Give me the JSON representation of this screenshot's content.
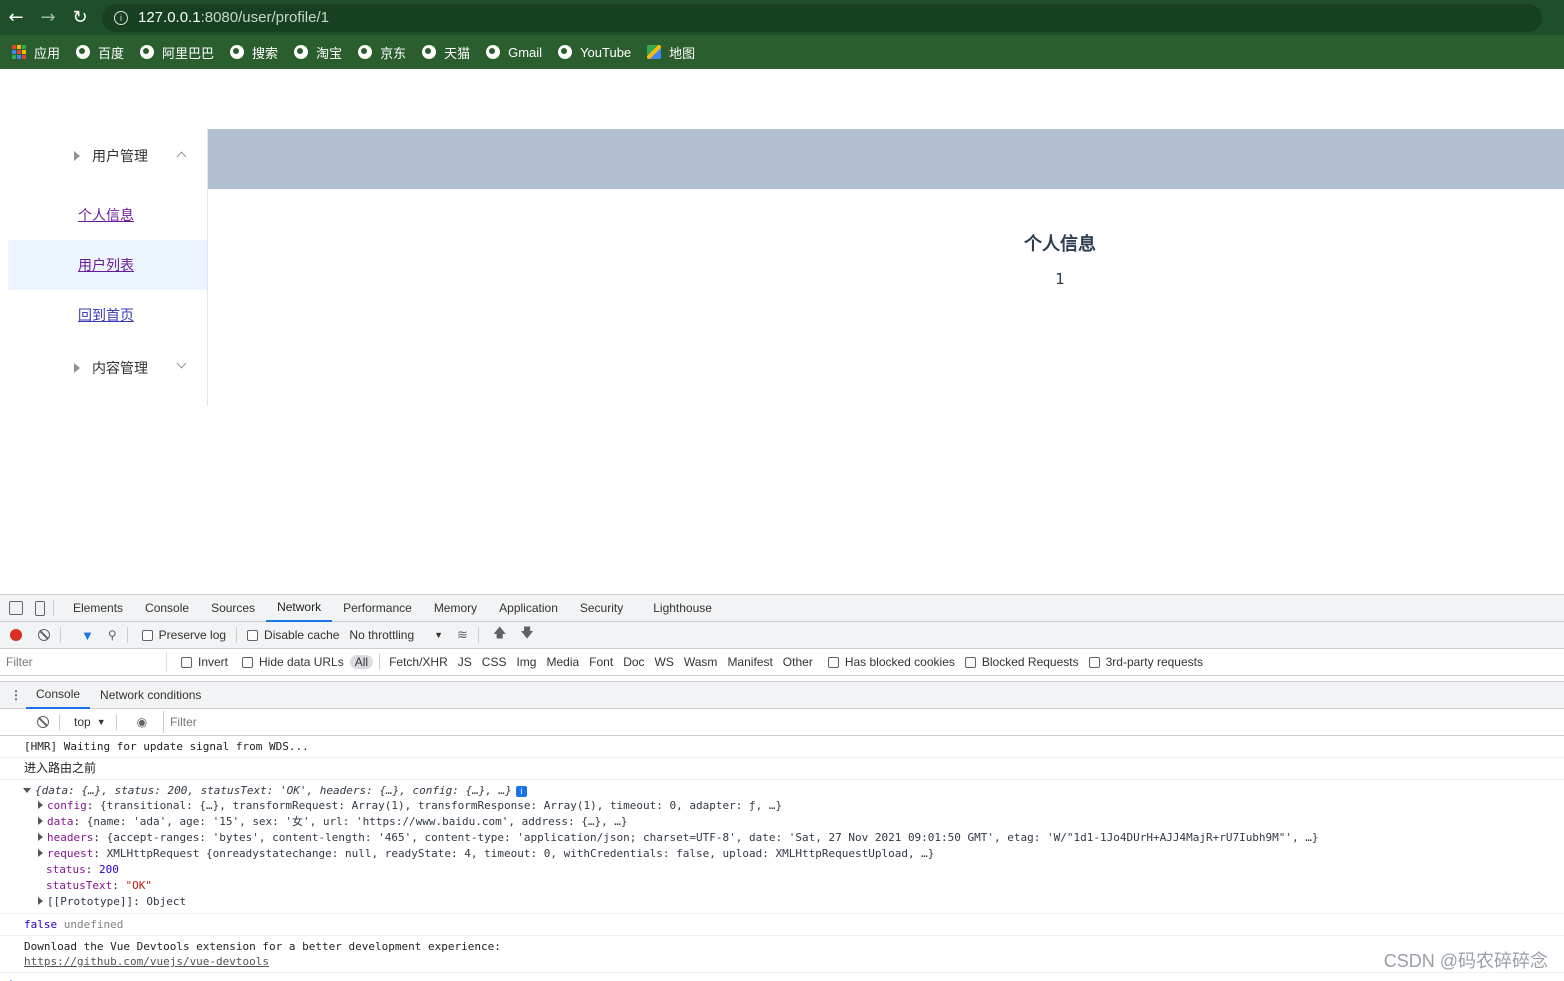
{
  "browser": {
    "url_host": "127.0.0.1",
    "url_path": ":8080/user/profile/1",
    "bookmarks": [
      {
        "label": "应用",
        "icon": "apps-grid-icon"
      },
      {
        "label": "百度",
        "icon": "globe-icon"
      },
      {
        "label": "阿里巴巴",
        "icon": "globe-icon"
      },
      {
        "label": "搜索",
        "icon": "globe-icon"
      },
      {
        "label": "淘宝",
        "icon": "globe-icon"
      },
      {
        "label": "京东",
        "icon": "globe-icon"
      },
      {
        "label": "天猫",
        "icon": "globe-icon"
      },
      {
        "label": "Gmail",
        "icon": "globe-icon"
      },
      {
        "label": "YouTube",
        "icon": "globe-icon"
      },
      {
        "label": "地图",
        "icon": "maps-icon"
      }
    ]
  },
  "sidebar": {
    "group1": "用户管理",
    "items": [
      "个人信息",
      "用户列表",
      "回到首页"
    ],
    "group2": "内容管理"
  },
  "main": {
    "title": "个人信息",
    "id": "1"
  },
  "devtools": {
    "tabs": [
      "Elements",
      "Console",
      "Sources",
      "Network",
      "Performance",
      "Memory",
      "Application",
      "Security",
      "Lighthouse"
    ],
    "network_toolbar": {
      "preserve_log": "Preserve log",
      "disable_cache": "Disable cache",
      "throttling": "No throttling"
    },
    "filter_row": {
      "placeholder": "Filter",
      "invert": "Invert",
      "hide_data_urls": "Hide data URLs",
      "types": [
        "All",
        "Fetch/XHR",
        "JS",
        "CSS",
        "Img",
        "Media",
        "Font",
        "Doc",
        "WS",
        "Wasm",
        "Manifest",
        "Other"
      ],
      "has_blocked_cookies": "Has blocked cookies",
      "blocked_requests": "Blocked Requests",
      "third_party": "3rd-party requests"
    },
    "drawer_tabs": [
      "Console",
      "Network conditions"
    ],
    "console_toolbar": {
      "context": "top",
      "filter_placeholder": "Filter"
    },
    "console": {
      "hmr": "[HMR] Waiting for update signal from WDS...",
      "route_msg": "进入路由之前",
      "obj_summary": "{data: {…}, status: 200, statusText: 'OK', headers: {…}, config: {…}, …}",
      "props": {
        "config_k": "config",
        "config_v": "{transitional: {…}, transformRequest: Array(1), transformResponse: Array(1), timeout: 0, adapter: ƒ, …}",
        "data_k": "data",
        "data_v": "{name: 'ada', age: '15', sex: '女', url: 'https://www.baidu.com', address: {…}, …}",
        "headers_k": "headers",
        "headers_v": "{accept-ranges: 'bytes', content-length: '465', content-type: 'application/json; charset=UTF-8', date: 'Sat, 27 Nov 2021 09:01:50 GMT', etag: 'W/\"1d1-1Jo4DUrH+AJJ4MajR+rU7Iubh9M\"', …}",
        "request_k": "request",
        "request_v": "XMLHttpRequest {onreadystatechange: null, readyState: 4, timeout: 0, withCredentials: false, upload: XMLHttpRequestUpload, …}",
        "status_k": "status",
        "status_v": "200",
        "statusText_k": "statusText",
        "statusText_v": "\"OK\"",
        "proto_k": "[[Prototype]]",
        "proto_v": "Object"
      },
      "false_line_a": "false",
      "false_line_b": "undefined",
      "vue_msg": "Download the Vue Devtools extension for a better development experience:",
      "vue_link": "https://github.com/vuejs/vue-devtools"
    }
  },
  "watermark": "CSDN @码农碎碎念"
}
